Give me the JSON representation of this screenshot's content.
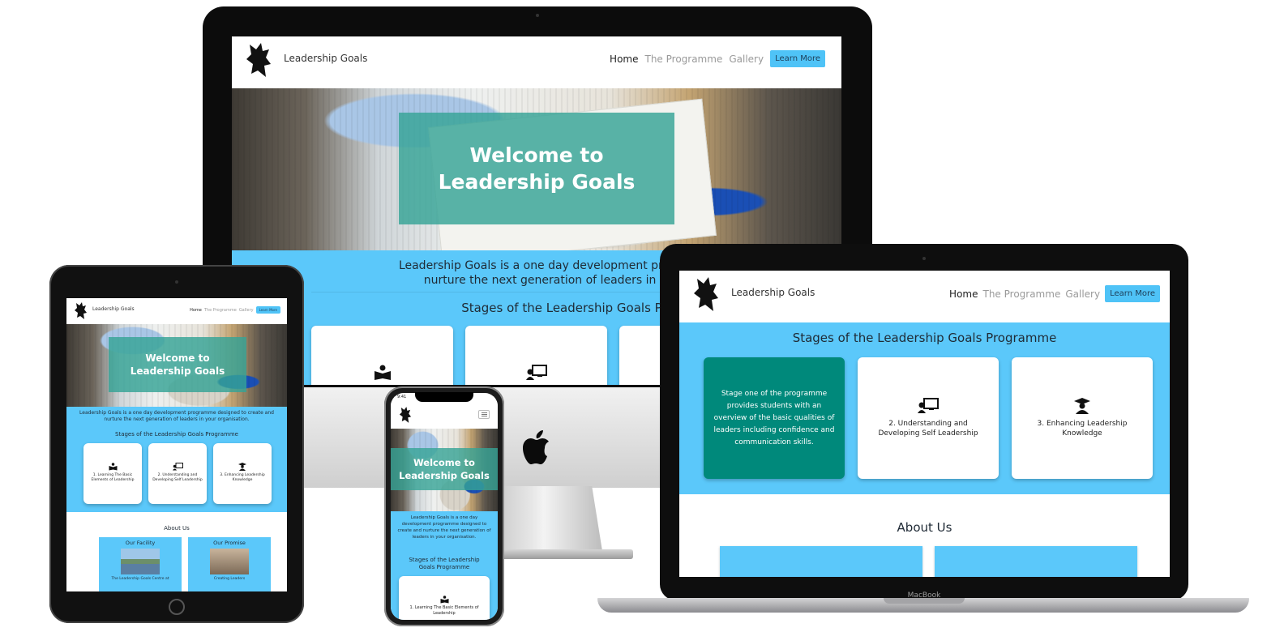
{
  "site": {
    "brand": "Leadership Goals",
    "nav": {
      "home": "Home",
      "programme": "The Programme",
      "gallery": "Gallery",
      "cta": "Learn More"
    },
    "hero_line1": "Welcome to",
    "hero_line2": "Leadership Goals",
    "hero_single": "Welcome to Leadership Goals",
    "intro_line1": "Leadership Goals is a one day development programme designed to",
    "intro_line2": "nurture the next generation of leaders in your organisation.",
    "intro_full": "Leadership Goals is a one day development programme designed to create and nurture the next generation of leaders in your organisation.",
    "stages_title": "Stages of the Leadership Goals Programme",
    "stages": [
      {
        "label": "1. Learning The Basic Elements of Leadership",
        "icon": "book-reader-icon"
      },
      {
        "label": "2. Understanding and Developing Self Leadership",
        "icon": "chalkboard-teacher-icon"
      },
      {
        "label": "3. Enhancing Leadership Knowledge",
        "icon": "graduate-icon"
      }
    ],
    "stage_one_detail": "Stage one of the programme provides students with an overview of the basic qualities of leaders including confidence and communication skills.",
    "about_title": "About Us",
    "about_facility": "Our Facility",
    "about_promise": "Our Promise",
    "about_facility_text": "The Leadership Goals Centre at",
    "about_promise_text": "Creating Leaders"
  },
  "devices": {
    "macbook_label": "MacBook",
    "phone_time": "9:41"
  },
  "colors": {
    "accent_blue": "#5bc8fa",
    "button_blue": "#4fc3f7",
    "teal_overlay": "#36a496",
    "teal_card": "#00897b"
  }
}
